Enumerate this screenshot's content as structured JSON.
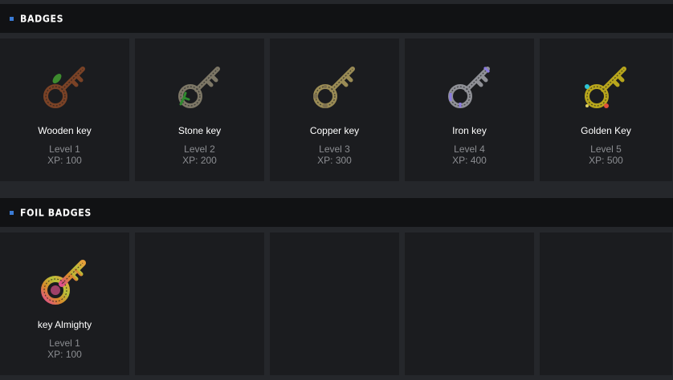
{
  "sections": [
    {
      "title": "BADGES",
      "items": [
        {
          "name": "Wooden key",
          "level": "Level 1",
          "xp": "XP: 100",
          "icon": "wooden-key-icon",
          "color": "#7a4226",
          "accent": "#3d8b2e"
        },
        {
          "name": "Stone key",
          "level": "Level 2",
          "xp": "XP: 200",
          "icon": "stone-key-icon",
          "color": "#7d7766",
          "accent": "#2f8a2f"
        },
        {
          "name": "Copper key",
          "level": "Level 3",
          "xp": "XP: 300",
          "icon": "copper-key-icon",
          "color": "#9a8b55",
          "accent": "#7d7050"
        },
        {
          "name": "Iron key",
          "level": "Level 4",
          "xp": "XP: 400",
          "icon": "iron-key-icon",
          "color": "#8f9096",
          "accent": "#8b7be0"
        },
        {
          "name": "Golden Key",
          "level": "Level 5",
          "xp": "XP: 500",
          "icon": "golden-key-icon",
          "color": "#b8a61c",
          "accent": "#2ec4d4"
        }
      ]
    },
    {
      "title": "FOIL BADGES",
      "items": [
        {
          "name": "key Almighty",
          "level": "Level 1",
          "xp": "XP: 100",
          "icon": "rainbow-key-icon",
          "color": "#c97a2a",
          "accent": "#e05080"
        },
        null,
        null,
        null,
        null
      ]
    }
  ]
}
